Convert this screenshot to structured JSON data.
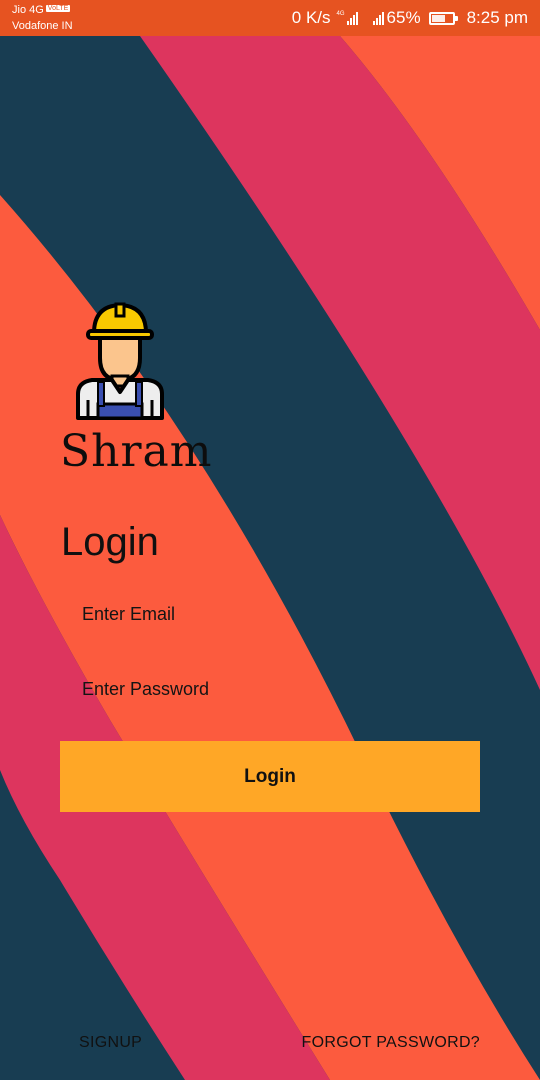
{
  "status_bar": {
    "carrier_primary": "Jio 4G",
    "volte_badge": "VoLTE",
    "carrier_secondary": "Vodafone IN",
    "data_speed": "0 K/s",
    "network_badge": "4G",
    "battery_percent": "65%",
    "battery_level": 0.65,
    "time": "8:25 pm",
    "icons": [
      "signal-icon",
      "signal-icon",
      "battery-icon"
    ]
  },
  "app": {
    "name": "Shram",
    "logo_icon": "construction-worker-icon"
  },
  "login": {
    "heading": "Login",
    "email_placeholder": "Enter Email",
    "password_placeholder": "Enter Password",
    "button_label": "Login",
    "signup_label": "SIGNUP",
    "forgot_label": "FORGOT PASSWORD?"
  },
  "colors": {
    "status_bar": "#e65321",
    "background_navy": "#183d52",
    "stripe_pink": "#dd355e",
    "stripe_orange": "#fc5b3e",
    "button": "#ffa726"
  }
}
